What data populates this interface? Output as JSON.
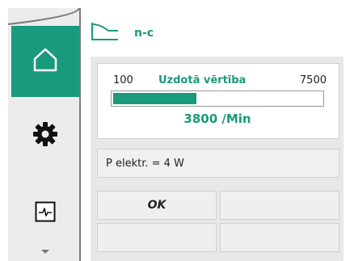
{
  "header": {
    "mode_icon": "control-curve-icon",
    "title": "n-c"
  },
  "sidebar": {
    "items": [
      {
        "name": "home",
        "icon": "home-icon",
        "active": true
      },
      {
        "name": "settings",
        "icon": "gear-icon",
        "active": false
      },
      {
        "name": "diagnostics",
        "icon": "monitor-icon",
        "active": false
      },
      {
        "name": "more",
        "icon": "chevron-down-icon",
        "active": false
      }
    ]
  },
  "setpoint": {
    "min": "100",
    "label": "Uzdotā vērtība",
    "max": "7500",
    "value_text": "3800 /Min",
    "fill_fraction": 0.4
  },
  "power": {
    "text": "P elektr. = 4 W"
  },
  "buttons": {
    "ok_label": "OK"
  },
  "colors": {
    "accent": "#1a9a7c",
    "rail": "#ececec"
  }
}
